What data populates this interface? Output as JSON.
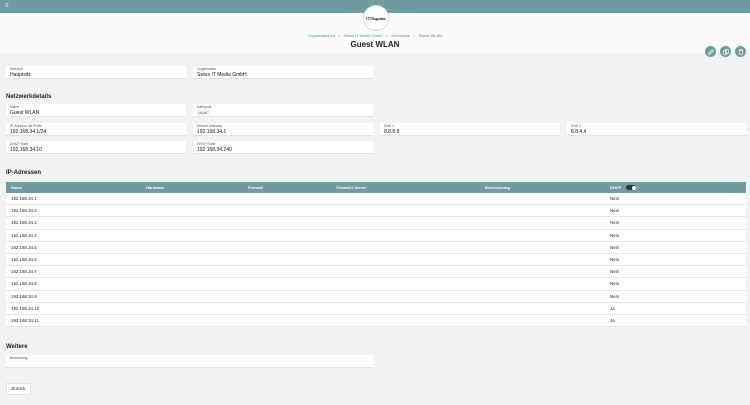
{
  "header": {
    "logo_text": "ITMagazine",
    "breadcrumb": [
      "Organisationen",
      "Swiss IT Media GmbH",
      "Netzwerke",
      "Guest WLAN"
    ],
    "title": "Guest WLAN"
  },
  "actions": {
    "edit_icon": "pencil-icon",
    "copy_icon": "copy-icon",
    "delete_icon": "trash-icon"
  },
  "top_fields": {
    "standort_label": "Standort",
    "standort_value": "Hauptsitz",
    "organisation_label": "Organisation",
    "organisation_value": "Swiss IT Media GmbH"
  },
  "netzwerk": {
    "title": "Netzwerkdetails",
    "name_label": "Name",
    "name_value": "Guest WLAN",
    "kategorie_label": "Kategorie",
    "kategorie_value": "WLAN",
    "ip_label": "IP-Adresse mit Prefix",
    "ip_value": "192.168.34.1/24",
    "gateway_label": "Default Gateway",
    "gateway_value": "192.168.34.1",
    "dns1_label": "DNS 1",
    "dns1_value": "8.8.8.8",
    "dns2_label": "DNS 2",
    "dns2_value": "8.8.4.4",
    "dhcp_start_label": "DHCP Start",
    "dhcp_start_value": "192.168.34.10",
    "dhcp_ende_label": "DHCP Ende",
    "dhcp_ende_value": "192.168.34.240"
  },
  "ip_section": {
    "title": "IP-Adressen",
    "columns": {
      "name": "Name",
      "hardware": "Hardware",
      "firewall": "Firewall",
      "server": "Virtueller Server",
      "bezeichnung": "Bezeichnung",
      "dhcp": "DHCP"
    },
    "rows": [
      {
        "ip": "192.168.34.1",
        "dhcp": "Nein"
      },
      {
        "ip": "192.168.34.2",
        "dhcp": "Nein"
      },
      {
        "ip": "192.168.34.3",
        "dhcp": "Nein"
      },
      {
        "ip": "192.168.34.4",
        "dhcp": "Nein"
      },
      {
        "ip": "192.168.34.5",
        "dhcp": "Nein"
      },
      {
        "ip": "192.168.34.6",
        "dhcp": "Nein"
      },
      {
        "ip": "192.168.34.7",
        "dhcp": "Nein"
      },
      {
        "ip": "192.168.34.8",
        "dhcp": "Nein"
      },
      {
        "ip": "192.168.34.9",
        "dhcp": "Nein"
      },
      {
        "ip": "192.168.34.10",
        "dhcp": "Ja"
      },
      {
        "ip": "192.168.34.11",
        "dhcp": "Ja"
      }
    ]
  },
  "weitere": {
    "title": "Weitere",
    "bemerkung_label": "Bemerkung",
    "bemerkung_value": ""
  },
  "footer": {
    "back_label": "Zurück"
  },
  "colors": {
    "accent": "#6f9ba1",
    "background": "#f1f2f3"
  }
}
